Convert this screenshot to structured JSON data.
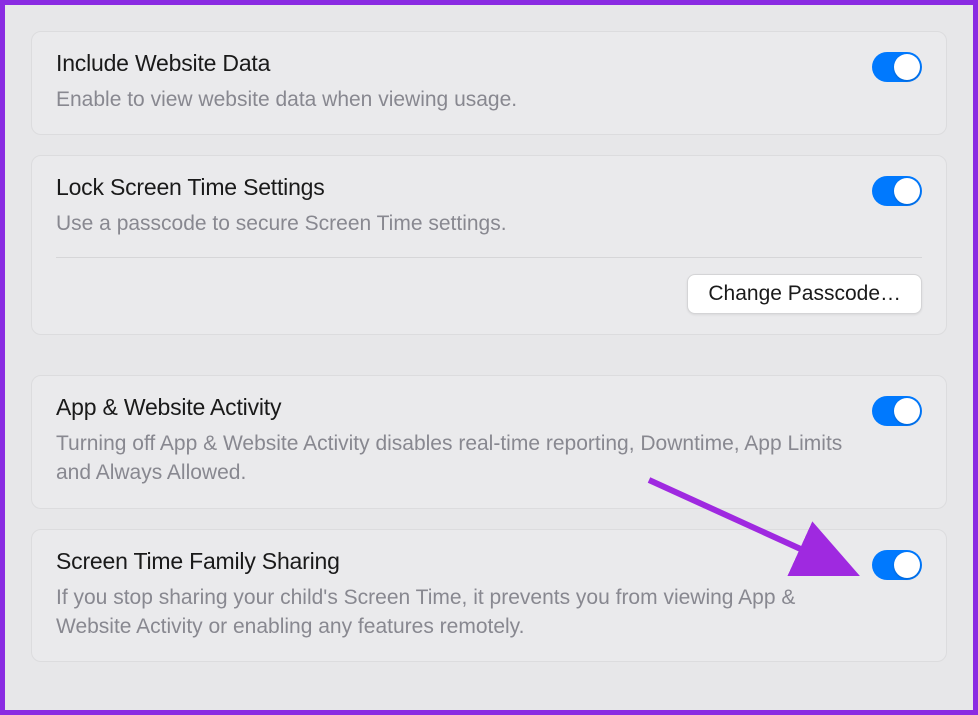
{
  "settings": [
    {
      "id": "include-website-data",
      "title": "Include Website Data",
      "description": "Enable to view website data when viewing usage.",
      "toggle": true
    },
    {
      "id": "lock-screen-time-settings",
      "title": "Lock Screen Time Settings",
      "description": "Use a passcode to secure Screen Time settings.",
      "toggle": true,
      "button": "Change Passcode…"
    },
    {
      "id": "app-website-activity",
      "title": "App & Website Activity",
      "description": "Turning off App & Website Activity disables real-time reporting, Downtime, App Limits and Always Allowed.",
      "toggle": true
    },
    {
      "id": "screen-time-family-sharing",
      "title": "Screen Time Family Sharing",
      "description": "If you stop sharing your child's Screen Time, it prevents you from viewing App & Website Activity or enabling any features remotely.",
      "toggle": true
    }
  ],
  "arrow_color": "#9f29e0"
}
